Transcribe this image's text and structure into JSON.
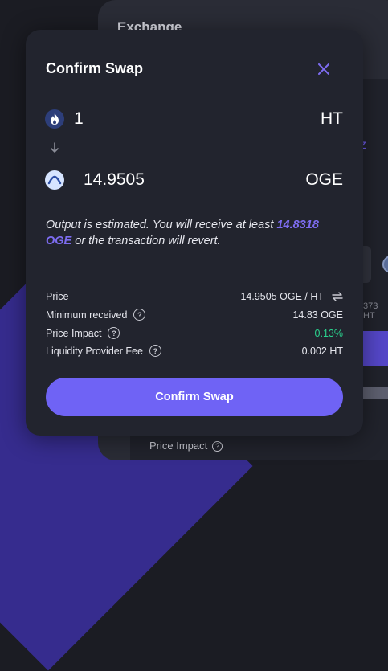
{
  "background": {
    "title": "Exchange",
    "side_text": "373 HT",
    "price_impact_label": "Price Impact"
  },
  "modal": {
    "title": "Confirm Swap",
    "input": {
      "amount": "1",
      "symbol": "HT"
    },
    "output": {
      "amount": "14.9505",
      "symbol": "OGE"
    },
    "note": {
      "prefix": "Output is estimated. You will receive at least ",
      "min_amount": "14.8318",
      "min_symbol": "OGE",
      "suffix": " or the transaction will revert."
    },
    "details": {
      "price_label": "Price",
      "price_value": "14.9505 OGE / HT",
      "min_received_label": "Minimum received",
      "min_received_value": "14.83 OGE",
      "price_impact_label": "Price Impact",
      "price_impact_value": "0.13%",
      "lp_fee_label": "Liquidity Provider Fee",
      "lp_fee_value": "0.002 HT"
    },
    "confirm_label": "Confirm Swap"
  },
  "colors": {
    "accent": "#6f63f5",
    "highlight": "#7d6cf0",
    "positive": "#2ad38e",
    "modal_bg": "#22242e"
  },
  "icons": {
    "close": "close-icon",
    "input_token": "ht-token-icon",
    "output_token": "oge-token-icon",
    "arrow": "arrow-down-icon",
    "swap_price": "swap-arrows-icon",
    "help": "question-circle-icon"
  }
}
